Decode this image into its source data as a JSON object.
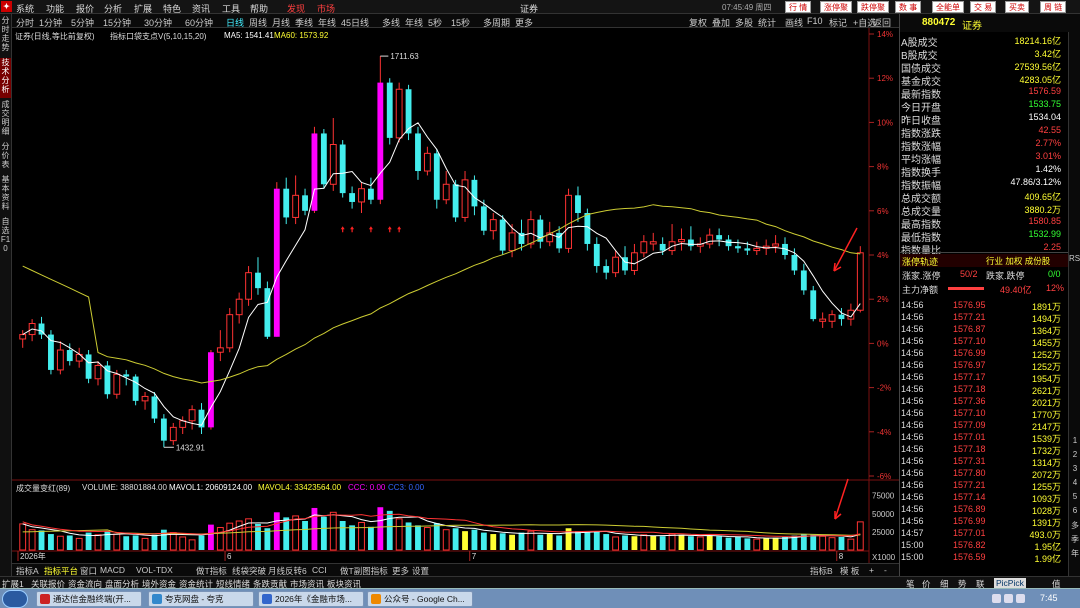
{
  "menubar": {
    "items": [
      "系统",
      "功能",
      "报价",
      "分析",
      "扩展",
      "特色",
      "资讯",
      "工具",
      "帮助"
    ],
    "hot": [
      "发现",
      "市场"
    ],
    "app_title": "证券",
    "clock": "07:45:49 周四",
    "tabs": [
      "行 情",
      "涨停聚",
      "跌停聚",
      "数 事",
      "全能单",
      "交 易",
      "买卖",
      "周 链"
    ]
  },
  "periods": {
    "items": [
      "分时",
      "1分钟",
      "5分钟",
      "15分钟",
      "30分钟",
      "60分钟",
      "日线",
      "周线",
      "月线",
      "季线",
      "年线",
      "45日线",
      "多线",
      "年线",
      "5秒",
      "15秒",
      "多周期",
      "更多"
    ],
    "active": "日线",
    "right": [
      "复权",
      "叠加",
      "多股",
      "统计",
      "画线",
      "F10",
      "标记",
      "+自选",
      "返回"
    ]
  },
  "sidetabs": [
    "分时走势",
    "技术分析",
    "成交明细",
    "分价表",
    "基本资料",
    "自选F10"
  ],
  "legend": {
    "main": "证券(日线,等比前复权)",
    "ind": "指标口袋支点V(5,10,15,20)",
    "ma5": "MA5: 1541.41",
    "ma60": "MA60: 1573.92",
    "high_label": "1711.63",
    "low_label": "1432.91",
    "vol_title": "成交量变红(89)",
    "volume": "VOLUME: 38801884.00",
    "mavol1": "MAVOL1: 20609124.00",
    "mavol4": "MAVOL4: 33423564.00",
    "ccc": "CCC: 0.00",
    "ccc2": "CC3: 0.00"
  },
  "chart_data": {
    "type": "candlestick",
    "y_axis": [
      "14%",
      "12%",
      "10%",
      "8%",
      "6%",
      "4%",
      "2%",
      "0%",
      "-2%",
      "-4%",
      "-6%"
    ],
    "vol_axis": [
      "75000",
      "50000",
      "25000",
      "X1000"
    ],
    "x_labels": [
      {
        "label": "2026年",
        "i": 0
      },
      {
        "label": "6",
        "i": 22
      },
      {
        "label": "7",
        "i": 48
      },
      {
        "label": "8",
        "i": 87
      }
    ],
    "candles": [
      [
        0.2,
        0.4,
        -0.2,
        0.6,
        0
      ],
      [
        0.4,
        0.9,
        0.1,
        1.1,
        0
      ],
      [
        0.9,
        0.4,
        0.2,
        1.2,
        1
      ],
      [
        0.4,
        -1.2,
        -1.4,
        0.6,
        1
      ],
      [
        -1.2,
        -0.3,
        -1.4,
        0.1,
        0
      ],
      [
        -0.3,
        -0.8,
        -1.0,
        0.0,
        1
      ],
      [
        -0.8,
        -0.5,
        -1.1,
        -0.2,
        0
      ],
      [
        -0.5,
        -1.6,
        -1.8,
        -0.3,
        1
      ],
      [
        -1.6,
        -1.0,
        -1.9,
        -0.8,
        0
      ],
      [
        -1.0,
        -2.3,
        -2.5,
        -0.8,
        1
      ],
      [
        -2.3,
        -1.4,
        -2.5,
        -1.2,
        0
      ],
      [
        -1.4,
        -1.5,
        -1.9,
        -1.2,
        1
      ],
      [
        -1.5,
        -2.6,
        -2.8,
        -1.4,
        1
      ],
      [
        -2.6,
        -2.4,
        -3.0,
        -2.2,
        0
      ],
      [
        -2.4,
        -3.4,
        -3.6,
        -2.2,
        1
      ],
      [
        -3.4,
        -4.4,
        -4.7,
        -3.2,
        1
      ],
      [
        -4.4,
        -3.8,
        -4.6,
        -3.6,
        0
      ],
      [
        -3.8,
        -3.5,
        -4.1,
        -3.3,
        0
      ],
      [
        -3.5,
        -3.0,
        -3.9,
        -2.8,
        0
      ],
      [
        -3.0,
        -3.8,
        -4.1,
        -2.7,
        1
      ],
      [
        -3.8,
        -0.4,
        -3.9,
        -0.3,
        0
      ],
      [
        -0.4,
        -0.2,
        -0.8,
        0.6,
        0
      ],
      [
        -0.2,
        1.3,
        -0.4,
        1.6,
        0
      ],
      [
        1.3,
        2.0,
        0.9,
        2.3,
        0
      ],
      [
        2.0,
        3.2,
        1.7,
        3.5,
        0
      ],
      [
        3.2,
        2.5,
        2.2,
        3.9,
        1
      ],
      [
        2.5,
        0.3,
        0.2,
        2.8,
        1
      ],
      [
        0.3,
        7.0,
        0.3,
        7.3,
        0
      ],
      [
        7.0,
        5.7,
        5.4,
        7.5,
        1
      ],
      [
        5.7,
        6.7,
        5.4,
        7.6,
        0
      ],
      [
        6.7,
        6.0,
        5.8,
        7.0,
        1
      ],
      [
        6.0,
        9.5,
        5.9,
        9.8,
        0
      ],
      [
        9.5,
        7.2,
        7.0,
        9.7,
        1
      ],
      [
        7.2,
        9.0,
        6.9,
        10.2,
        0
      ],
      [
        9.0,
        6.8,
        6.6,
        9.2,
        1
      ],
      [
        6.8,
        6.4,
        6.1,
        7.1,
        1
      ],
      [
        6.4,
        7.0,
        5.9,
        7.3,
        0
      ],
      [
        7.0,
        6.5,
        6.3,
        7.5,
        1
      ],
      [
        6.5,
        11.8,
        6.3,
        13.0,
        0
      ],
      [
        11.8,
        9.3,
        9.0,
        12.0,
        1
      ],
      [
        9.3,
        11.5,
        9.1,
        11.8,
        0
      ],
      [
        11.5,
        9.5,
        9.2,
        11.7,
        1
      ],
      [
        9.5,
        7.8,
        7.4,
        9.8,
        1
      ],
      [
        7.8,
        8.6,
        7.6,
        8.9,
        0
      ],
      [
        8.6,
        6.5,
        6.1,
        8.8,
        1
      ],
      [
        6.5,
        7.2,
        6.3,
        7.8,
        0
      ],
      [
        7.2,
        5.7,
        5.5,
        7.4,
        1
      ],
      [
        5.7,
        7.4,
        5.5,
        7.8,
        0
      ],
      [
        7.4,
        6.2,
        5.8,
        7.6,
        1
      ],
      [
        6.2,
        5.1,
        4.9,
        6.5,
        1
      ],
      [
        5.1,
        5.6,
        4.7,
        5.9,
        0
      ],
      [
        5.6,
        4.2,
        4.0,
        5.8,
        1
      ],
      [
        4.2,
        5.0,
        3.9,
        5.4,
        0
      ],
      [
        5.0,
        4.5,
        4.2,
        5.6,
        1
      ],
      [
        4.5,
        5.6,
        4.3,
        6.0,
        0
      ],
      [
        5.6,
        4.6,
        4.3,
        5.8,
        1
      ],
      [
        4.6,
        5.0,
        4.4,
        5.5,
        0
      ],
      [
        5.0,
        4.3,
        4.1,
        5.3,
        1
      ],
      [
        4.3,
        6.7,
        4.1,
        7.0,
        0
      ],
      [
        6.7,
        5.9,
        5.5,
        7.1,
        1
      ],
      [
        5.9,
        4.5,
        4.2,
        6.1,
        1
      ],
      [
        4.5,
        3.5,
        3.2,
        4.8,
        1
      ],
      [
        3.5,
        3.2,
        2.9,
        3.8,
        1
      ],
      [
        3.2,
        3.9,
        3.0,
        4.2,
        0
      ],
      [
        3.9,
        3.3,
        3.1,
        4.4,
        1
      ],
      [
        3.3,
        4.1,
        3.1,
        4.5,
        0
      ],
      [
        4.1,
        4.6,
        3.9,
        4.9,
        0
      ],
      [
        4.6,
        4.5,
        4.2,
        5.0,
        0
      ],
      [
        4.5,
        4.2,
        4.0,
        4.8,
        1
      ],
      [
        4.2,
        4.6,
        4.0,
        5.4,
        0
      ],
      [
        4.6,
        4.7,
        4.2,
        5.2,
        0
      ],
      [
        4.7,
        4.4,
        4.2,
        5.3,
        1
      ],
      [
        4.4,
        4.5,
        4.1,
        4.8,
        0
      ],
      [
        4.5,
        4.9,
        4.3,
        5.2,
        0
      ],
      [
        4.9,
        4.7,
        4.4,
        5.2,
        1
      ],
      [
        4.7,
        4.4,
        4.2,
        4.9,
        1
      ],
      [
        4.4,
        4.3,
        4.1,
        4.7,
        1
      ],
      [
        4.3,
        4.2,
        4.0,
        4.6,
        1
      ],
      [
        4.2,
        4.3,
        4.0,
        4.6,
        0
      ],
      [
        4.3,
        4.4,
        4.0,
        4.7,
        0
      ],
      [
        4.4,
        4.5,
        4.1,
        4.9,
        0
      ],
      [
        4.5,
        4.0,
        3.8,
        4.8,
        1
      ],
      [
        4.0,
        3.3,
        3.1,
        4.3,
        1
      ],
      [
        3.3,
        2.4,
        2.2,
        3.6,
        1
      ],
      [
        2.4,
        1.1,
        1.0,
        2.6,
        1
      ],
      [
        1.1,
        1.0,
        0.7,
        1.4,
        0
      ],
      [
        1.0,
        1.3,
        0.7,
        1.5,
        0
      ],
      [
        1.3,
        1.1,
        0.8,
        1.6,
        1
      ],
      [
        1.1,
        1.5,
        0.8,
        1.8,
        0
      ],
      [
        1.5,
        4.1,
        1.4,
        4.4,
        0
      ]
    ],
    "volumes": [
      [
        36000,
        0
      ],
      [
        28000,
        0
      ],
      [
        27000,
        1
      ],
      [
        22000,
        1
      ],
      [
        19000,
        0
      ],
      [
        20000,
        1
      ],
      [
        16000,
        0
      ],
      [
        24000,
        1
      ],
      [
        21000,
        0
      ],
      [
        26000,
        1
      ],
      [
        22000,
        0
      ],
      [
        19000,
        1
      ],
      [
        20000,
        1
      ],
      [
        16000,
        0
      ],
      [
        21000,
        1
      ],
      [
        28000,
        1
      ],
      [
        24000,
        0
      ],
      [
        18000,
        0
      ],
      [
        14000,
        0
      ],
      [
        20000,
        1
      ],
      [
        35000,
        0
      ],
      [
        31000,
        0
      ],
      [
        37000,
        0
      ],
      [
        40000,
        0
      ],
      [
        43000,
        0
      ],
      [
        36000,
        1
      ],
      [
        30000,
        1
      ],
      [
        52000,
        0
      ],
      [
        45000,
        1
      ],
      [
        47000,
        0
      ],
      [
        40000,
        1
      ],
      [
        58000,
        0
      ],
      [
        46000,
        1
      ],
      [
        52000,
        0
      ],
      [
        40000,
        1
      ],
      [
        34000,
        1
      ],
      [
        38000,
        0
      ],
      [
        32000,
        1
      ],
      [
        59000,
        0
      ],
      [
        54000,
        1
      ],
      [
        43000,
        0
      ],
      [
        38000,
        1
      ],
      [
        34000,
        1
      ],
      [
        31000,
        0
      ],
      [
        37000,
        1
      ],
      [
        28000,
        0
      ],
      [
        30000,
        1
      ],
      [
        26000,
        0
      ],
      [
        28000,
        1
      ],
      [
        24000,
        1
      ],
      [
        22000,
        0
      ],
      [
        23000,
        1
      ],
      [
        21000,
        0
      ],
      [
        24000,
        1
      ],
      [
        26000,
        0
      ],
      [
        21000,
        1
      ],
      [
        22000,
        0
      ],
      [
        20000,
        1
      ],
      [
        30000,
        0
      ],
      [
        26000,
        1
      ],
      [
        24000,
        1
      ],
      [
        26000,
        1
      ],
      [
        22000,
        1
      ],
      [
        18000,
        0
      ],
      [
        20000,
        1
      ],
      [
        19000,
        0
      ],
      [
        21000,
        0
      ],
      [
        20000,
        0
      ],
      [
        19000,
        1
      ],
      [
        22000,
        0
      ],
      [
        21000,
        0
      ],
      [
        19000,
        1
      ],
      [
        18000,
        0
      ],
      [
        20000,
        0
      ],
      [
        19000,
        1
      ],
      [
        17000,
        1
      ],
      [
        18000,
        1
      ],
      [
        16000,
        1
      ],
      [
        15000,
        0
      ],
      [
        16000,
        0
      ],
      [
        17000,
        0
      ],
      [
        18000,
        1
      ],
      [
        20000,
        1
      ],
      [
        22000,
        1
      ],
      [
        21000,
        1
      ],
      [
        19000,
        0
      ],
      [
        17000,
        0
      ],
      [
        18000,
        1
      ],
      [
        15000,
        0
      ],
      [
        38800,
        0
      ]
    ]
  },
  "quote": {
    "code": "880472",
    "name": "证券",
    "rows": [
      {
        "label": "A股成交",
        "val": "18214.16亿",
        "c": "c-yellow"
      },
      {
        "label": "B股成交",
        "val": "3.42亿",
        "c": "c-yellow"
      },
      {
        "label": "国债成交",
        "val": "27539.56亿",
        "c": "c-yellow"
      },
      {
        "label": "基金成交",
        "val": "4283.05亿",
        "c": "c-yellow"
      },
      {
        "label": "最新指数",
        "val": "1576.59",
        "c": "c-red"
      },
      {
        "label": "今日开盘",
        "val": "1533.75",
        "c": "c-green"
      },
      {
        "label": "昨日收盘",
        "val": "1534.04",
        "c": "c-white"
      },
      {
        "label": "指数涨跌",
        "val": "42.55",
        "c": "c-red"
      },
      {
        "label": "指数涨幅",
        "val": "2.77%",
        "c": "c-red"
      },
      {
        "label": "平均涨幅",
        "val": "3.01%",
        "c": "c-red"
      },
      {
        "label": "指数换手",
        "val": "1.42%",
        "c": "c-white"
      },
      {
        "label": "指数振幅",
        "val": "47.86/3.12%",
        "c": "c-white"
      },
      {
        "label": "总成交额",
        "val": "409.65亿",
        "c": "c-yellow"
      },
      {
        "label": "总成交量",
        "val": "3880.2万",
        "c": "c-yellow"
      },
      {
        "label": "最高指数",
        "val": "1580.85",
        "c": "c-red"
      },
      {
        "label": "最低指数",
        "val": "1532.99",
        "c": "c-green"
      },
      {
        "label": "指数量比",
        "val": "2.25",
        "c": "c-red"
      }
    ],
    "track": "涨停轨迹",
    "track_right": "行业 加权 成份股",
    "zt_label": "涨家.涨停",
    "zt_val": "50/2",
    "dt_label": "跌家.跌停",
    "dt_val": "0/0",
    "flow_label": "主力净额",
    "flow_val": "49.40亿",
    "flow_pct": "12%"
  },
  "ticks": [
    [
      "14:56",
      "1576.95",
      "1891万"
    ],
    [
      "14:56",
      "1577.21",
      "1494万"
    ],
    [
      "14:56",
      "1576.87",
      "1364万"
    ],
    [
      "14:56",
      "1577.10",
      "1455万"
    ],
    [
      "14:56",
      "1576.99",
      "1252万"
    ],
    [
      "14:56",
      "1576.97",
      "1252万"
    ],
    [
      "14:56",
      "1577.17",
      "1954万"
    ],
    [
      "14:56",
      "1577.18",
      "2621万"
    ],
    [
      "14:56",
      "1577.36",
      "2021万"
    ],
    [
      "14:56",
      "1577.10",
      "1770万"
    ],
    [
      "14:56",
      "1577.09",
      "2147万"
    ],
    [
      "14:56",
      "1577.01",
      "1539万"
    ],
    [
      "14:56",
      "1577.18",
      "1732万"
    ],
    [
      "14:56",
      "1577.31",
      "1314万"
    ],
    [
      "14:56",
      "1577.80",
      "2072万"
    ],
    [
      "14:56",
      "1577.21",
      "1255万"
    ],
    [
      "14:56",
      "1577.14",
      "1093万"
    ],
    [
      "14:56",
      "1576.89",
      "1028万"
    ],
    [
      "14:56",
      "1576.99",
      "1391万"
    ],
    [
      "14:57",
      "1577.01",
      "493.0万"
    ],
    [
      "15:00",
      "1576.82",
      "1.95亿"
    ],
    [
      "15:00",
      "1576.59",
      "1.99亿"
    ]
  ],
  "rstrip": [
    "RSI",
    "1",
    "2",
    "3",
    "4",
    "5",
    "6",
    "多",
    "季",
    "年"
  ],
  "bottomtabs": {
    "items": [
      "指标A",
      "指标平台",
      "窗口",
      "MACD",
      "VOL-TDX",
      "做T指标",
      "线袋突破",
      "月线反转6",
      "CCI",
      "做T副图指标",
      "更多",
      "设置"
    ],
    "active": "指标平台",
    "right": [
      "指标B",
      "模 板",
      "+",
      "-"
    ]
  },
  "statusbar": {
    "items": [
      "扩展1",
      "关联报价",
      "资金流向",
      "盘面分析",
      "境外资金",
      "资金统计",
      "短线情绪",
      "条跌贡献",
      "市场资讯",
      "板块资讯"
    ],
    "right": [
      "笔",
      "价",
      "细",
      "势",
      "联",
      "值"
    ],
    "pick": "PicPick"
  },
  "taskbar": {
    "tasks": [
      "通达信金融终端(开...",
      "夸克网盘 - 夸克",
      "2026年《金融市场...",
      "公众号 - Google Ch..."
    ],
    "clock": "7:45"
  }
}
